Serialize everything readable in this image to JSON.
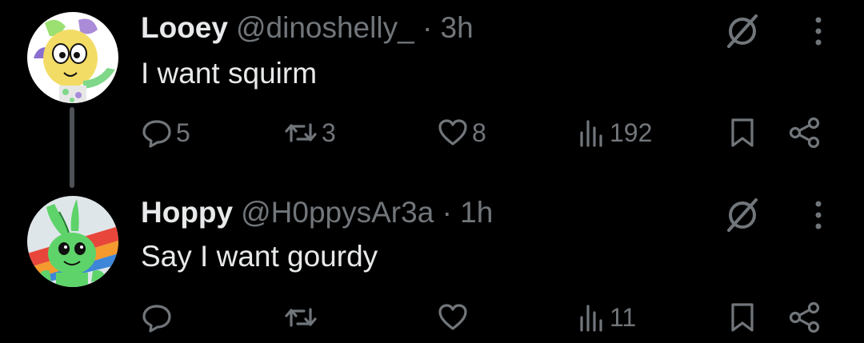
{
  "posts": [
    {
      "display_name": "Looey",
      "handle": "@dinoshelly_",
      "separator": "·",
      "time": "3h",
      "text": "I want squirm",
      "replies": "5",
      "reposts": "3",
      "likes": "8",
      "views": "192"
    },
    {
      "display_name": "Hoppy",
      "handle": "@H0ppysAr3a",
      "separator": "·",
      "time": "1h",
      "text": "Say I want gourdy",
      "replies": "",
      "reposts": "",
      "likes": "",
      "views": "11"
    }
  ],
  "icons": {
    "reply": "speech-bubble-icon",
    "repost": "repost-arrows-icon",
    "like": "heart-icon",
    "views": "bar-chart-icon",
    "bookmark": "bookmark-icon",
    "share": "share-nodes-icon",
    "grok": "grok-slash-circle-icon",
    "more": "vertical-ellipsis-icon"
  },
  "colors": {
    "background": "#000000",
    "primary_text": "#e7e9ea",
    "secondary_text": "#71767b",
    "thread_line": "#4d5257"
  }
}
